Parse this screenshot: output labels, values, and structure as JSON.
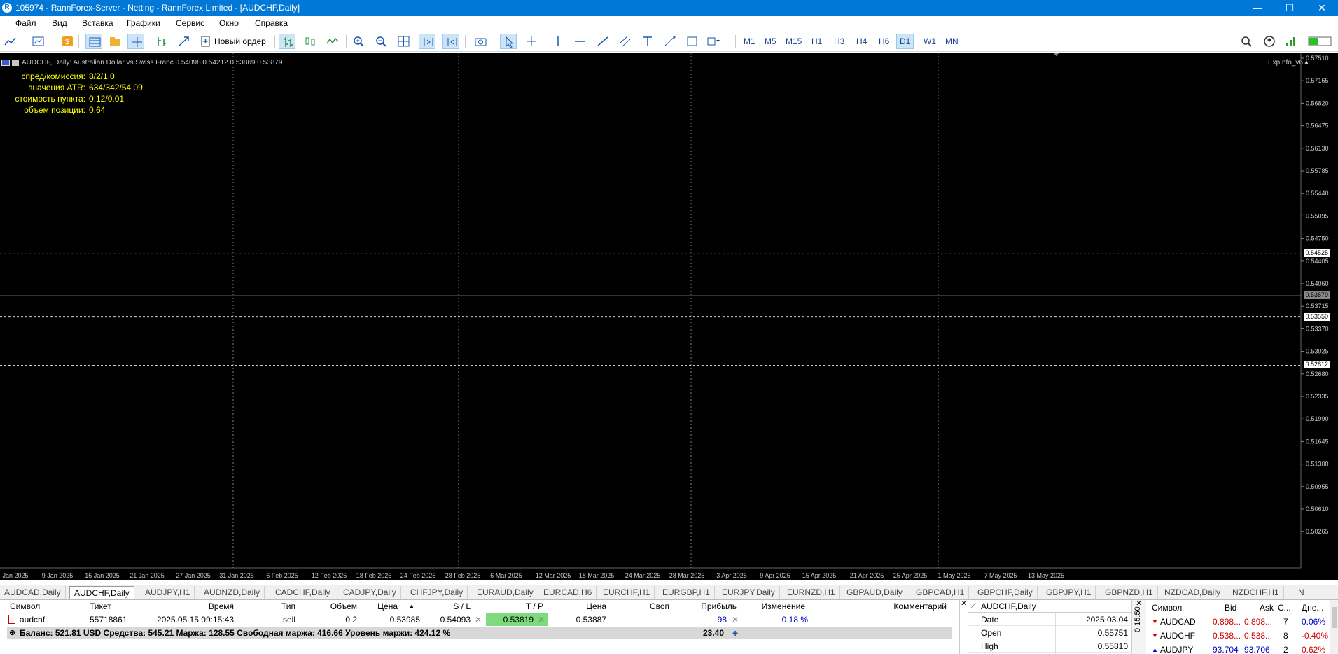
{
  "window": {
    "title": "105974 - RannForex-Server - Netting - RannForex Limited - [AUDCHF,Daily]",
    "app_icon": "R",
    "min": "—",
    "max": "☐",
    "close": "✕"
  },
  "menu": [
    "Файл",
    "Вид",
    "Вставка",
    "Графики",
    "Сервис",
    "Окно",
    "Справка"
  ],
  "toolbar": {
    "new_order": "Новый ордер",
    "timeframes": [
      "M1",
      "M5",
      "M15",
      "H1",
      "H3",
      "H4",
      "H6",
      "D1",
      "W1",
      "MN"
    ],
    "active_timeframe": "D1"
  },
  "chart": {
    "header": "AUDCHF, Daily:  Australian Dollar vs Swiss Franc  0.54098 0.54212 0.53869 0.53879",
    "expinfo": "ExpInfo_v6",
    "info": [
      {
        "key": "спред/комиссия:",
        "value": "8/2/1.0"
      },
      {
        "key": "значения ATR:",
        "value": "634/342/54.09"
      },
      {
        "key": "стоимость пункта:",
        "value": "0.12/0.01"
      },
      {
        "key": "объем позиции:",
        "value": "0.64"
      }
    ],
    "price_labels": [
      "0.57510",
      "0.57165",
      "0.56820",
      "0.56475",
      "0.56130",
      "0.55785",
      "0.55440",
      "0.55095",
      "0.54750",
      "0.54405",
      "0.54060",
      "0.53715",
      "0.53370",
      "0.53025",
      "0.52680",
      "0.52335",
      "0.51990",
      "0.51645",
      "0.51300",
      "0.50955",
      "0.50610",
      "0.50265"
    ],
    "price_tags": [
      {
        "value": "0.54525",
        "style": "white"
      },
      {
        "value": "0.53879",
        "style": "grey"
      },
      {
        "value": "0.53550",
        "style": "white"
      },
      {
        "value": "0.52812",
        "style": "white"
      }
    ],
    "date_labels": [
      "Jan 2025",
      "9 Jan 2025",
      "15 Jan 2025",
      "21 Jan 2025",
      "27 Jan 2025",
      "31 Jan 2025",
      "6 Feb 2025",
      "12 Feb 2025",
      "18 Feb 2025",
      "24 Feb 2025",
      "28 Feb 2025",
      "6 Mar 2025",
      "12 Mar 2025",
      "18 Mar 2025",
      "24 Mar 2025",
      "28 Mar 2025",
      "3 Apr 2025",
      "9 Apr 2025",
      "15 Apr 2025",
      "21 Apr 2025",
      "25 Apr 2025",
      "1 May 2025",
      "7 May 2025",
      "13 May 2025"
    ],
    "colors": {
      "bars": "#ffff00",
      "background": "#000000",
      "axis_text": "#c8c8c8",
      "grid": "#808080"
    }
  },
  "symbol_tabs": [
    "AUDCAD,Daily",
    "AUDCHF,Daily",
    "AUDJPY,H1",
    "AUDNZD,Daily",
    "CADCHF,Daily",
    "CADJPY,Daily",
    "CHFJPY,Daily",
    "EURAUD,Daily",
    "EURCAD,H6",
    "EURCHF,H1",
    "EURGBP,H1",
    "EURJPY,Daily",
    "EURNZD,H1",
    "GBPAUD,Daily",
    "GBPCAD,H1",
    "GBPCHF,Daily",
    "GBPJPY,H1",
    "GBPNZD,H1",
    "NZDCAD,Daily",
    "NZDCHF,H1",
    "N"
  ],
  "active_symbol_tab": "AUDCHF,Daily",
  "trade": {
    "headers": {
      "symbol": "Символ",
      "ticket": "Тикет",
      "time": "Время",
      "type": "Тип",
      "volume": "Объем",
      "price": "Цена",
      "sl": "S / L",
      "tp": "T / P",
      "cur_price": "Цена",
      "swap": "Своп",
      "profit": "Прибыль",
      "change": "Изменение",
      "comment": "Комментарий"
    },
    "row": {
      "symbol": "audchf",
      "ticket": "55718861",
      "time": "2025.05.15 09:15:43",
      "type": "sell",
      "volume": "0.2",
      "price": "0.53985",
      "sl": "0.54093",
      "tp": "0.53819",
      "cur_price": "0.53887",
      "swap": "",
      "profit": "98",
      "change": "0.18 %",
      "comment": ""
    },
    "balance": "Баланс: 521.81 USD  Средства: 545.21  Маржа: 128.55  Свободная маржа: 416.66  Уровень маржи: 424.12 %",
    "total_profit": "23.40"
  },
  "data_window": {
    "title": "AUDCHF,Daily",
    "rows": [
      {
        "key": "Date",
        "value": "2025.03.04"
      },
      {
        "key": "Open",
        "value": "0.55751"
      },
      {
        "key": "High",
        "value": "0.55810"
      }
    ]
  },
  "clock": "0:15:50",
  "market_watch": {
    "headers": {
      "symbol": "Символ",
      "bid": "Bid",
      "ask": "Ask",
      "spread": "С...",
      "change": "Дне..."
    },
    "rows": [
      {
        "symbol": "AUDCAD",
        "bid": "0.898...",
        "ask": "0.898...",
        "spread": "7",
        "change": "0.06%",
        "color": "blue"
      },
      {
        "symbol": "AUDCHF",
        "bid": "0.538...",
        "ask": "0.538...",
        "spread": "8",
        "change": "-0.40%",
        "color": "red"
      },
      {
        "symbol": "AUDJPY",
        "bid": "93.704",
        "ask": "93.706",
        "spread": "2",
        "change": "0.62%",
        "color": "blue"
      }
    ]
  }
}
